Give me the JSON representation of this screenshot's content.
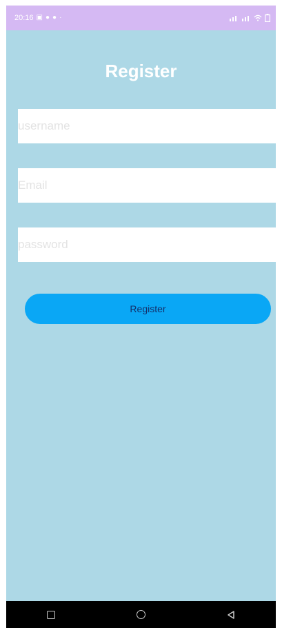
{
  "status_bar": {
    "time": "20:16",
    "left_icons": [
      "notification-icon",
      "app-icon",
      "app-icon",
      "dot-icon"
    ],
    "right_icons": [
      "signal-icon",
      "signal-icon",
      "wifi-icon",
      "battery-icon"
    ],
    "background_color": "#d5b9f3"
  },
  "screen": {
    "title": "Register",
    "background_color": "#add8e6"
  },
  "form": {
    "username_placeholder": "username",
    "username_value": "",
    "email_placeholder": "Email",
    "email_value": "",
    "password_placeholder": "password",
    "password_value": "",
    "submit_label": "Register",
    "submit_color": "#0aa7f5"
  },
  "nav_bar": {
    "buttons": [
      "recent-apps-icon",
      "home-icon",
      "back-icon"
    ]
  }
}
